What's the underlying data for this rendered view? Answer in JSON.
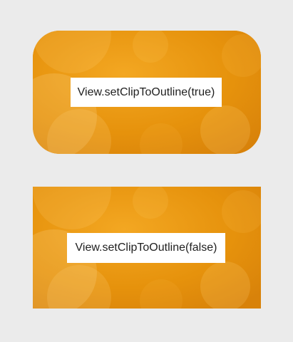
{
  "screen": {
    "background": "#ebebeb"
  },
  "cards": [
    {
      "label": "View.setClipToOutline(true)",
      "clip_to_outline": true,
      "image": "orange-bokeh-photo"
    },
    {
      "label": "View.setClipToOutline(false)",
      "clip_to_outline": false,
      "image": "orange-bokeh-photo"
    }
  ],
  "colors": {
    "card_base": "#e8960f",
    "label_background": "#ffffff",
    "label_text": "#1f1f1f"
  }
}
